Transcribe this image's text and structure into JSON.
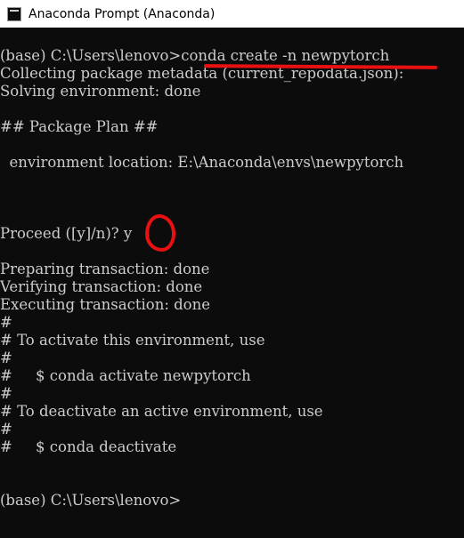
{
  "window": {
    "title": "Anaconda Prompt (Anaconda)",
    "icon": "terminal-icon"
  },
  "terminal": {
    "lines": [
      "(base) C:\\Users\\lenovo>conda create -n newpytorch",
      "Collecting package metadata (current_repodata.json):",
      "Solving environment: done",
      "",
      "## Package Plan ##",
      "",
      "  environment location: E:\\Anaconda\\envs\\newpytorch",
      "",
      "",
      "",
      "Proceed ([y]/n)? y",
      "",
      "Preparing transaction: done",
      "Verifying transaction: done",
      "Executing transaction: done",
      "#",
      "# To activate this environment, use",
      "#",
      "#     $ conda activate newpytorch",
      "#",
      "# To deactivate an active environment, use",
      "#",
      "#     $ conda deactivate",
      "",
      "",
      "(base) C:\\Users\\lenovo>"
    ]
  },
  "colors": {
    "background": "#0c0c0c",
    "text": "#cccccc",
    "annotation": "#e81010",
    "titlebar": "#ffffff"
  }
}
